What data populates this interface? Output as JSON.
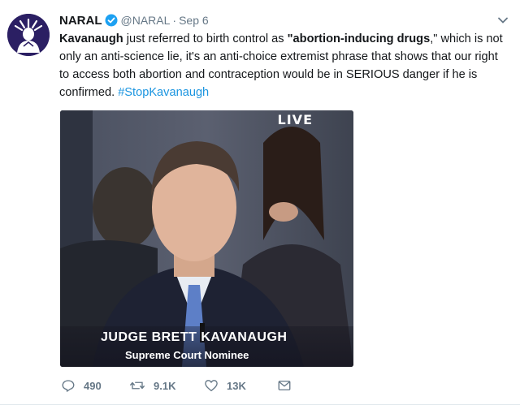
{
  "tweet": {
    "author_name": "NARAL",
    "handle": "@NARAL",
    "separator": "·",
    "date": "Sep 6",
    "text_parts": [
      "Kavanaugh",
      " just referred to birth control as ",
      "\"abortion-inducing drugs",
      ",\" which is not only an anti-science lie, it's an anti-choice extremist phrase that shows that our right to access both abortion and contraception would be in SERIOUS danger if he is confirmed. ",
      "#StopKavanaugh"
    ],
    "media": {
      "live_label": "LIVE",
      "caption_title": "JUDGE BRETT KAVANAUGH",
      "caption_subtitle": "Supreme Court Nominee"
    },
    "actions": {
      "replies": "490",
      "retweets": "9.1K",
      "likes": "13K"
    }
  },
  "colors": {
    "avatar_bg": "#2b1f63",
    "verified": "#1da1f2",
    "link": "#1b95e0",
    "muted": "#657786"
  },
  "icons": [
    "statue-of-liberty-logo",
    "verified-badge-icon",
    "chevron-down-icon",
    "reply-icon",
    "retweet-icon",
    "like-icon",
    "direct-message-icon"
  ]
}
